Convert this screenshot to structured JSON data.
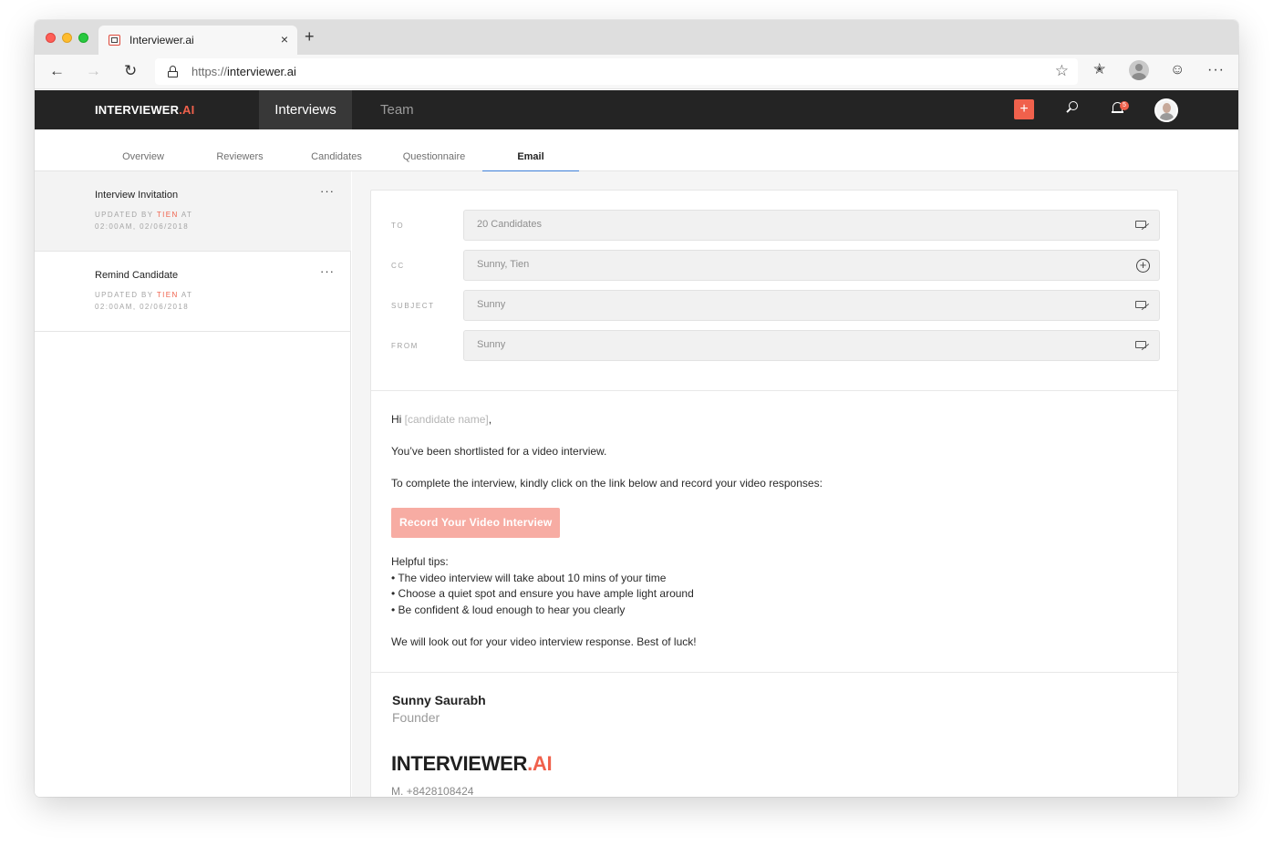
{
  "browser": {
    "tab_title": "Interviewer.ai",
    "tab_close": "×",
    "new_tab": "+",
    "url_protocol": "https://",
    "url_host": "interviewer.ai"
  },
  "app": {
    "logo_main": "INTERVIEWER",
    "logo_dot": ".AI",
    "nav": {
      "interviews": "Interviews",
      "team": "Team"
    },
    "add_label": "+",
    "notification_count": "5"
  },
  "subtabs": [
    {
      "label": "Overview"
    },
    {
      "label": "Reviewers"
    },
    {
      "label": "Candidates"
    },
    {
      "label": "Questionnaire"
    },
    {
      "label": "Email"
    }
  ],
  "templates": [
    {
      "title": "Interview Invitation",
      "meta_prefix": "UPDATED BY ",
      "meta_user": "TIEN",
      "meta_suffix": " AT",
      "meta_time": "02:00AM, 02/06/2018",
      "more": "···"
    },
    {
      "title": "Remind Candidate",
      "meta_prefix": "UPDATED BY ",
      "meta_user": "TIEN",
      "meta_suffix": " AT",
      "meta_time": "02:00AM, 02/06/2018",
      "more": "···"
    }
  ],
  "email": {
    "fields": {
      "to": {
        "label": "TO",
        "value": "20 Candidates"
      },
      "cc": {
        "label": "CC",
        "value": "Sunny, Tien"
      },
      "subject": {
        "label": "SUBJECT",
        "value": "Sunny"
      },
      "from": {
        "label": "FROM",
        "value": "Sunny"
      }
    },
    "body": {
      "greeting": "Hi ",
      "candidate_placeholder": "[candidate name]",
      "greeting_end": ",",
      "line1": "You’ve been shortlisted for a video interview.",
      "line2": "To complete the interview, kindly click on the link below and record your video responses:",
      "cta": "Record Your Video Interview",
      "tips_heading": "Helpful tips:",
      "tips": [
        "• The video interview will take about 10 mins of your time",
        "• Choose a quiet spot and ensure you have ample light around",
        "• Be confident & loud enough to hear you clearly"
      ],
      "closing": "We will look out for your video interview response. Best of luck!"
    },
    "signature": {
      "name": "Sunny Saurabh",
      "title": "Founder",
      "logo_main": "INTERVIEWER",
      "logo_dot": ".AI",
      "phone": "M. +8428108424"
    }
  },
  "colors": {
    "accent": "#f0614c",
    "tab_active": "#3d7fd8",
    "header_bg": "#242424"
  }
}
